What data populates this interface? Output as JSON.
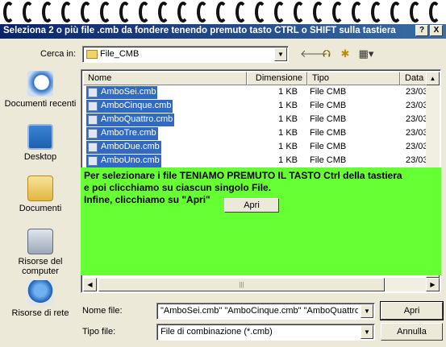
{
  "dialog": {
    "title": "Seleziona 2 o più file .cmb da fondere tenendo premuto tasto CTRL o SHIFT sulla tastiera",
    "help_button": "?",
    "close_button": "X"
  },
  "toolbar": {
    "look_in_label": "Cerca in:",
    "look_in_value": "File_CMB",
    "back_icon": "back-arrow-icon",
    "up_icon": "up-folder-icon",
    "new_folder_icon": "new-folder-icon",
    "view_menu_icon": "view-menu-icon"
  },
  "places": [
    {
      "label": "Documenti recenti",
      "icon": "recent-documents-icon"
    },
    {
      "label": "Desktop",
      "icon": "desktop-icon"
    },
    {
      "label": "Documenti",
      "icon": "documents-folder-icon"
    },
    {
      "label": "Risorse del computer",
      "icon": "my-computer-icon"
    },
    {
      "label": "Risorse di rete",
      "icon": "network-places-icon"
    }
  ],
  "file_list": {
    "columns": [
      "Nome",
      "Dimensione",
      "Tipo",
      "Data"
    ],
    "rows": [
      {
        "name": "AmboSei.cmb",
        "size": "1 KB",
        "type": "File CMB",
        "date": "23/03"
      },
      {
        "name": "AmboCinque.cmb",
        "size": "1 KB",
        "type": "File CMB",
        "date": "23/03"
      },
      {
        "name": "AmboQuattro.cmb",
        "size": "1 KB",
        "type": "File CMB",
        "date": "23/03"
      },
      {
        "name": "AmboTre.cmb",
        "size": "1 KB",
        "type": "File CMB",
        "date": "23/03"
      },
      {
        "name": "AmboDue.cmb",
        "size": "1 KB",
        "type": "File CMB",
        "date": "23/03"
      },
      {
        "name": "AmboUno.cmb",
        "size": "1 KB",
        "type": "File CMB",
        "date": "23/03"
      }
    ]
  },
  "overlay_note": {
    "line1": "Per selezionare i file TENIAMO PREMUTO IL TASTO Ctrl della tastiera",
    "line2": "e poi clicchiamo su ciascun singolo File.",
    "line3": "Infine, clicchiamo su \"Apri\"",
    "button_label": "Apri",
    "background": "#66ff33"
  },
  "bottom": {
    "file_name_label": "Nome file:",
    "file_name_value": "\"AmboSei.cmb\" \"AmboCinque.cmb\" \"AmboQuattro.c",
    "file_type_label": "Tipo file:",
    "file_type_value": "File di combinazione (*.cmb)",
    "open_button": "Apri",
    "cancel_button": "Annulla"
  },
  "colors": {
    "selection": "#316ac5",
    "title_bar": "#0a246a"
  }
}
